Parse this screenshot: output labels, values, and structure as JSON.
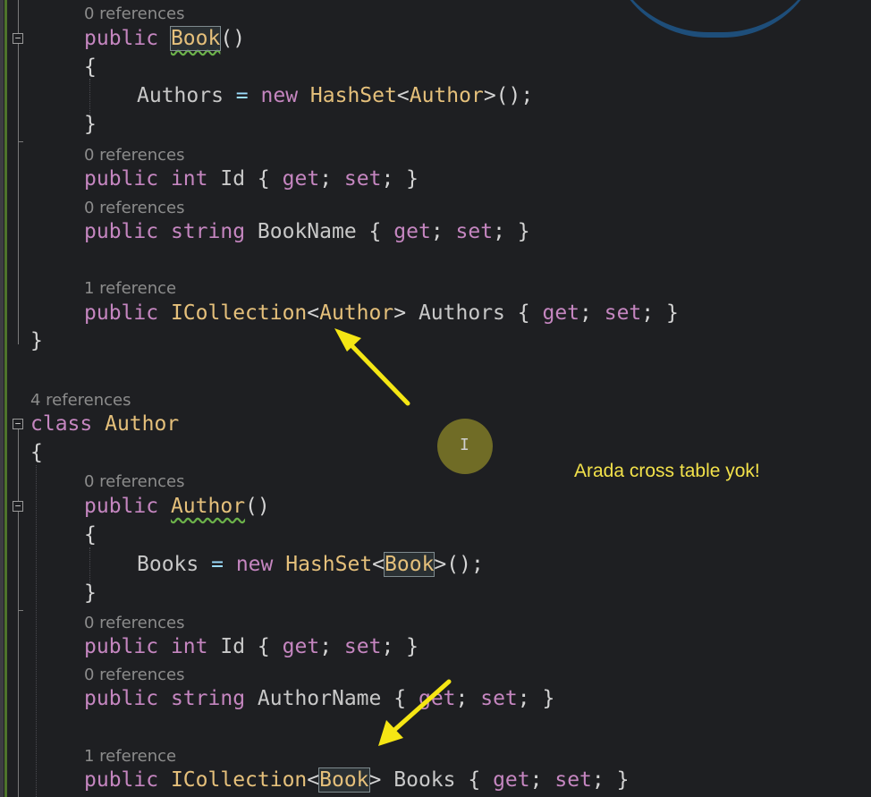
{
  "code_lens": {
    "book_ctor": "0 references",
    "book_id": "0 references",
    "book_name": "0 references",
    "book_authors": "1 reference",
    "author_class": "4 references",
    "author_ctor": "0 references",
    "author_id": "0 references",
    "author_name": "0 references",
    "author_books": "1 reference"
  },
  "code": {
    "kw_public": "public",
    "kw_new": "new",
    "kw_int": "int",
    "kw_string": "string",
    "kw_get": "get",
    "kw_set": "set",
    "kw_class": "class",
    "type_book": "Book",
    "type_author": "Author",
    "type_hashset": "HashSet",
    "type_icollection": "ICollection",
    "prop_authors": "Authors",
    "prop_books": "Books",
    "prop_id": "Id",
    "prop_bookname": "BookName",
    "prop_authorname": "AuthorName"
  },
  "annotation": {
    "note": "Arada cross table yok!"
  },
  "colors": {
    "keyword": "#c586c0",
    "type": "#e5c07b",
    "identifier": "#d4d4d4",
    "arrow": "#f5e614",
    "note": "#f2e14a",
    "background": "#1e1f22"
  }
}
